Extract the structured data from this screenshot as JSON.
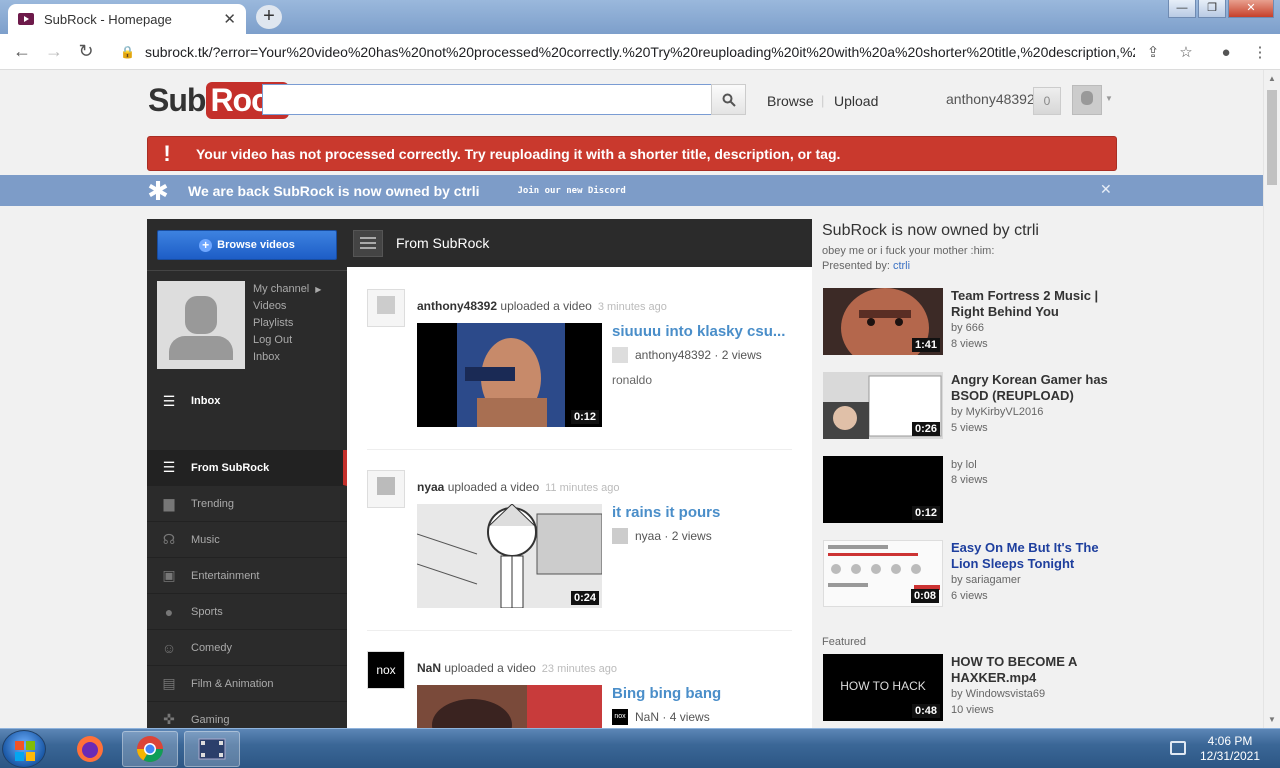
{
  "browser": {
    "tab_title": "SubRock - Homepage",
    "url": "subrock.tk/?error=Your%20video%20has%20not%20processed%20correctly.%20Try%20reuploading%20it%20with%20a%20shorter%20title,%20description,%2..."
  },
  "header": {
    "logo_sub": "Sub",
    "logo_rock": "Rock",
    "search_value": "",
    "browse": "Browse",
    "upload": "Upload",
    "username": "anthony48392",
    "notifications": "0"
  },
  "alert": {
    "icon": "!",
    "message": "Your video has not processed correctly. Try reuploading it with a shorter title, description, or tag."
  },
  "banner": {
    "text": "We are back SubRock is now owned by ctrli",
    "discord": "Join our new Discord"
  },
  "guide": {
    "browse_videos": "Browse videos",
    "profile_links": [
      "My channel",
      "Videos",
      "Playlists",
      "Log Out",
      "Inbox"
    ],
    "inbox": "Inbox",
    "items": [
      "From SubRock",
      "Trending",
      "Music",
      "Entertainment",
      "Sports",
      "Comedy",
      "Film & Animation",
      "Gaming"
    ]
  },
  "feed": {
    "title": "From SubRock",
    "items": [
      {
        "user": "anthony48392",
        "action": "uploaded a video",
        "time": "3 minutes ago",
        "title": "siuuuu into klasky csu...",
        "channel": "anthony48392",
        "views": "· 2 views",
        "desc": "ronaldo",
        "duration": "0:12"
      },
      {
        "user": "nyaa",
        "action": "uploaded a video",
        "time": "11 minutes ago",
        "title": "it rains it pours",
        "channel": "nyaa",
        "views": "· 2 views",
        "desc": "",
        "duration": "0:24"
      },
      {
        "user": "NaN",
        "action": "uploaded a video",
        "time": "23 minutes ago",
        "title": "Bing bing bang",
        "channel": "NaN",
        "views": "· 4 views",
        "desc": "",
        "duration": "",
        "avatar_text": "nox"
      }
    ]
  },
  "sidebar_right": {
    "title": "SubRock is now owned by ctrli",
    "subtitle": "obey me or i fuck your mother :him:",
    "presented_label": "Presented by:",
    "presented_by": "ctrli",
    "videos": [
      {
        "title": "Team Fortress 2 Music | Right Behind You",
        "by": "by 666",
        "views": "8 views",
        "duration": "1:41"
      },
      {
        "title": "Angry Korean Gamer has BSOD (REUPLOAD)",
        "by": "by MyKirbyVL2016",
        "views": "5 views",
        "duration": "0:26"
      },
      {
        "title": "",
        "by": "by lol",
        "views": "8 views",
        "duration": "0:12"
      },
      {
        "title": "Easy On Me But It's The Lion Sleeps Tonight",
        "by": "by sariagamer",
        "views": "6 views",
        "duration": "0:08"
      }
    ],
    "featured_label": "Featured",
    "featured": {
      "title": "HOW TO BECOME A HAXKER.mp4",
      "by": "by Windowsvista69",
      "views": "10 views",
      "duration": "0:48",
      "thumb_text": "HOW TO HACK"
    }
  },
  "taskbar": {
    "time": "4:06 PM",
    "date": "12/31/2021"
  }
}
